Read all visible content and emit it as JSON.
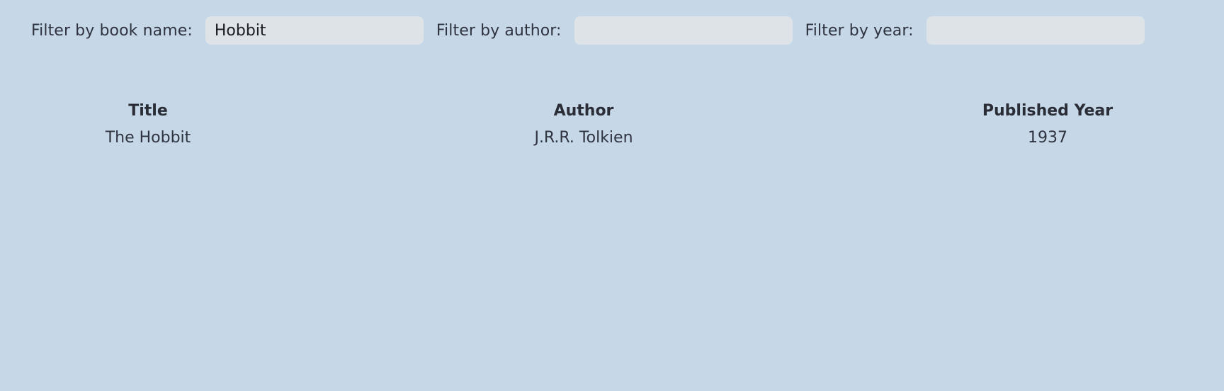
{
  "filters": {
    "book_name": {
      "label": "Filter by book name:",
      "value": "Hobbit",
      "placeholder": ""
    },
    "author": {
      "label": "Filter by author:",
      "value": "",
      "placeholder": ""
    },
    "year": {
      "label": "Filter by year:",
      "value": "",
      "placeholder": ""
    }
  },
  "table": {
    "headers": {
      "title": "Title",
      "author": "Author",
      "year": "Published Year"
    },
    "rows": [
      {
        "title": "The Hobbit",
        "author": "J.R.R. Tolkien",
        "year": "1937"
      }
    ]
  },
  "colors": {
    "background": "#c6d8e8",
    "input_background": "#dee3e8",
    "text": "#2a2d36"
  }
}
